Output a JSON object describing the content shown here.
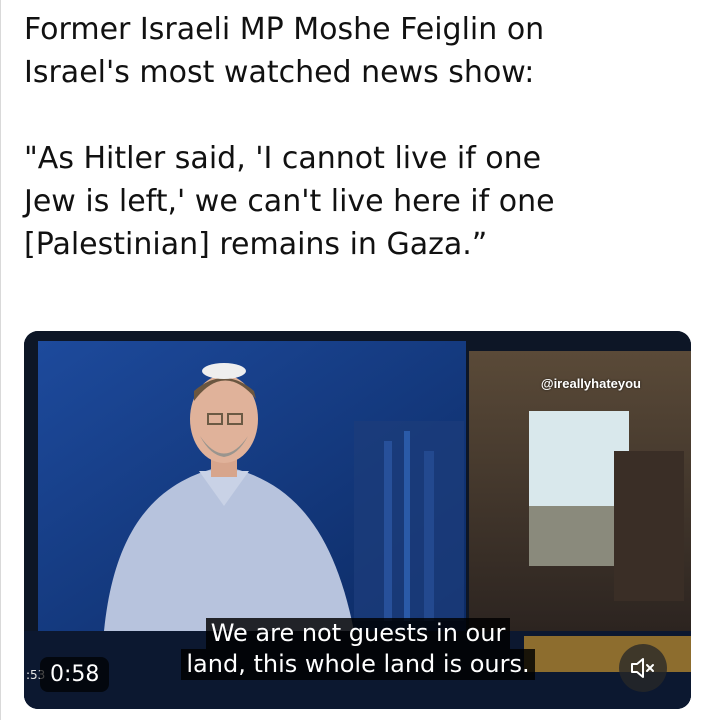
{
  "post": {
    "paragraph1": [
      "Former Israeli MP Moshe Feiglin on",
      "Israel's most watched news show:"
    ],
    "paragraph2": [
      "\"As Hitler said, 'I cannot live if one",
      "Jew is left,' we can't live here if one",
      "[Palestinian] remains in Gaza.”"
    ]
  },
  "video": {
    "watermark": "@ireallyhateyou",
    "subtitle_lines": [
      "We are not guests in our",
      "land, this whole land is ours."
    ],
    "timestamp": "0:58",
    "side_digits": ":53",
    "mute_icon": "speaker-muted-icon"
  }
}
